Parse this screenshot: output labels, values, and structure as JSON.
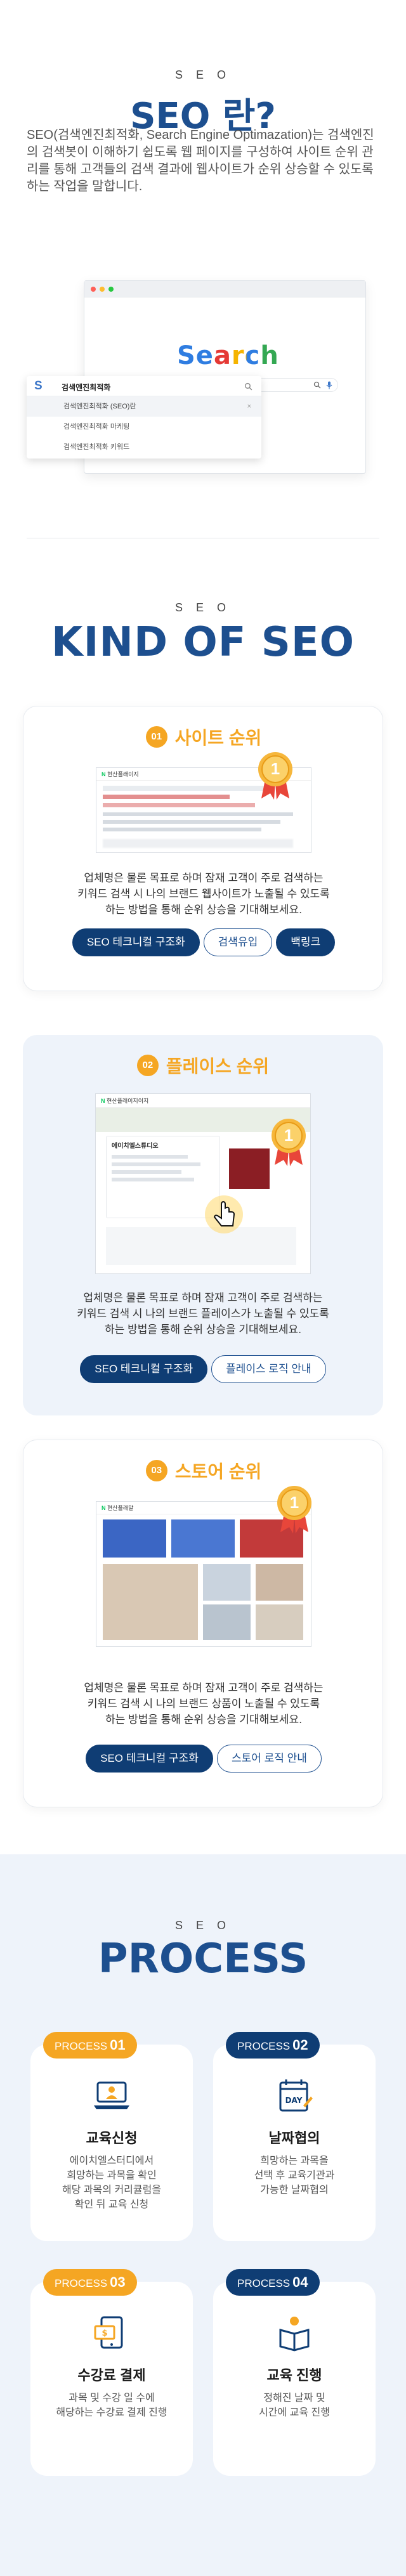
{
  "intro": {
    "eyebrow": "S E O",
    "title": "SEO 란?",
    "text": "SEO(검색엔진최적화, Search Engine Optimazation)는 검색엔진의 검색봇이 이해하기 쉽도록 웹 페이지를 구성하여 사이트 순위 관리를 통해 고객들의 검색 결과에 웹사이트가 순위 상승할 수 있도록 하는 작업을 말합니다.",
    "search_logo": "Search",
    "dropdown": {
      "logo": "S",
      "query": "검색엔진최적화",
      "items": [
        "검색엔진최적화 (SEO)란",
        "검색엔진최적화 마케팅",
        "검색엔진최적화 키워드"
      ]
    }
  },
  "kinds": {
    "eyebrow": "S E O",
    "title": "KIND OF SEO",
    "cards": [
      {
        "num": "01",
        "title": "사이트 순위",
        "desc_lines": [
          "업체명은 물론 목표로 하며 잠재 고객이 주로 검색하는",
          "키워드 검색 시 나의 브랜드 웹사이트가 노출될 수 있도록",
          "하는 방법을 통해 순위 상승을 기대해보세요."
        ],
        "buttons": [
          "SEO 테크니컬 구조화",
          "검색유입",
          "백링크"
        ],
        "thumb": {
          "title": "현산플래이지",
          "rank_badge": "1"
        }
      },
      {
        "num": "02",
        "title": "플레이스 순위",
        "desc_lines": [
          "업체명은 물론 목표로 하며 잠재 고객이 주로 검색하는",
          "키워드 검색 시 나의 브랜드 플레이스가 노출될 수 있도록",
          "하는 방법을 통해 순위 상승을 기대해보세요."
        ],
        "buttons": [
          "SEO 테크니컬 구조화",
          "플레이스 로직 안내"
        ],
        "thumb": {
          "title": "현산플래이지이지",
          "place_name": "에이치엘스튜디오",
          "rank_badge": "1"
        }
      },
      {
        "num": "03",
        "title": "스토어 순위",
        "desc_lines": [
          "업체명은 물론 목표로 하며 잠재 고객이 주로 검색하는",
          "키워드 검색 시 나의 브랜드 상품이 노출될 수 있도록",
          "하는 방법을 통해 순위 상승을 기대해보세요."
        ],
        "buttons": [
          "SEO 테크니컬 구조화",
          "스토어 로직 안내"
        ],
        "thumb": {
          "title": "현산플래말",
          "rank_badge": "1"
        }
      }
    ]
  },
  "process": {
    "eyebrow": "S E O",
    "title": "PROCESS",
    "steps": [
      {
        "tag": "PROCESS",
        "num": "01",
        "title": "교육신청",
        "desc_lines": [
          "에이치엘스터디에서",
          "희망하는 과목을 확인",
          "해당 과목의 커리큘럼을",
          "확인 뒤 교육 신청"
        ],
        "icon": "laptop-user-icon",
        "tag_color": "#f5a623"
      },
      {
        "tag": "PROCESS",
        "num": "02",
        "title": "날짜협의",
        "desc_lines": [
          "희망하는 과목을",
          "선택 후 교육기관과",
          "가능한 날짜협의"
        ],
        "icon": "calendar-day-icon",
        "icon_text": "DAY",
        "tag_color": "#0f3d74"
      },
      {
        "tag": "PROCESS",
        "num": "03",
        "title": "수강료 결제",
        "desc_lines": [
          "과목 및 수강 일 수에",
          "해당하는 수강료 결제 진행"
        ],
        "icon": "payment-phone-icon",
        "tag_color": "#f5a623"
      },
      {
        "tag": "PROCESS",
        "num": "04",
        "title": "교육 진행",
        "desc_lines": [
          "정해진 날짜 및",
          "시간에 교육 진행"
        ],
        "icon": "reading-person-icon",
        "tag_color": "#0f3d74"
      }
    ]
  }
}
